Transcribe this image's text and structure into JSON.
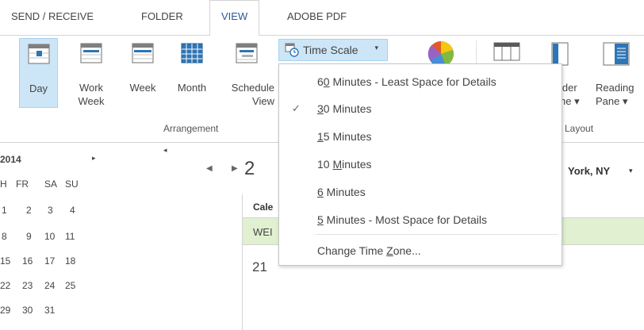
{
  "tabs": [
    {
      "label": "SEND / RECEIVE"
    },
    {
      "label": "FOLDER"
    },
    {
      "label": "VIEW"
    },
    {
      "label": "ADOBE PDF"
    }
  ],
  "ribbon": {
    "buttons": {
      "day": "Day",
      "work_week": "Work\nWeek",
      "week": "Week",
      "month": "Month",
      "schedule_view": "Schedule\nView",
      "folder_pane": "lder\nne ▾",
      "reading_pane": "Reading\nPane ▾"
    },
    "time_scale": {
      "label": "Time Scale",
      "caret": "▾"
    },
    "group_labels": {
      "arrangement": "Arrangement",
      "layout": "Layout"
    }
  },
  "time_scale_menu": {
    "items": [
      {
        "pre": "6",
        "key": "0",
        "post": " Minutes - Least Space for Details",
        "checked": false
      },
      {
        "pre": "",
        "key": "3",
        "post": "0 Minutes",
        "checked": true
      },
      {
        "pre": "",
        "key": "1",
        "post": "5 Minutes",
        "checked": false
      },
      {
        "pre": "10 ",
        "key": "M",
        "post": "inutes",
        "checked": false
      },
      {
        "pre": "",
        "key": "6",
        "post": " Minutes",
        "checked": false
      },
      {
        "pre": "",
        "key": "5",
        "post": " Minutes - Most Space for Details",
        "checked": false
      }
    ],
    "change_zone": {
      "pre": "Change Time ",
      "key": "Z",
      "post": "one..."
    },
    "check_glyph": "✓"
  },
  "mini_calendar": {
    "year": "2014",
    "next_arrow": "▸",
    "day_headers": [
      "H",
      "FR",
      "SA",
      "SU"
    ],
    "weeks": [
      [
        "1",
        "2",
        "3",
        "4"
      ],
      [
        "8",
        "9",
        "10",
        "11"
      ],
      [
        "15",
        "16",
        "17",
        "18"
      ],
      [
        "22",
        "23",
        "24",
        "25"
      ],
      [
        "29",
        "30",
        "31"
      ]
    ]
  },
  "calendar": {
    "collapse_arrow": "◂",
    "prev_arrow": "◀",
    "next_arrow": "▶",
    "date_fragment": "2",
    "location": "York, NY",
    "location_caret": "▾",
    "calendar_name": "Cale",
    "weekday": "WEI",
    "day_number": "21"
  },
  "colors": {
    "accent": "#2b579a",
    "selected_fill": "#cde6f7",
    "day_strip": "#e0f0d0"
  }
}
